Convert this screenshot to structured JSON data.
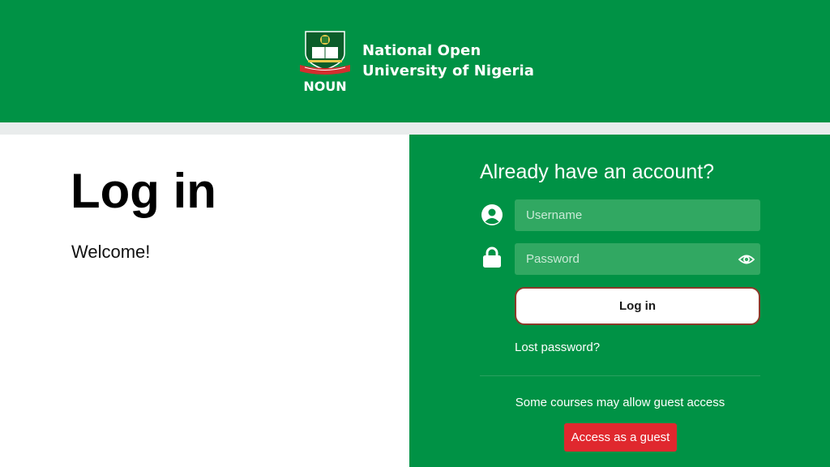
{
  "header": {
    "logo_icon": "noun-crest-logo",
    "brand_line1": "National Open",
    "brand_line2": "University of Nigeria"
  },
  "left": {
    "title": "Log in",
    "welcome": "Welcome!"
  },
  "login": {
    "heading": "Already have an account?",
    "username_placeholder": "Username",
    "username_value": "",
    "username_icon": "user-circle-icon",
    "password_placeholder": "Password",
    "password_value": "",
    "password_icon": "lock-icon",
    "reveal_icon": "eye-icon",
    "login_label": "Log in",
    "lost_password": "Lost password?"
  },
  "guest": {
    "info": "Some courses may allow guest access",
    "button_label": "Access as a guest"
  },
  "colors": {
    "brand_green": "#009245",
    "input_green": "#31a862",
    "guest_red": "#e0282e",
    "page_gap": "#e9ecec"
  }
}
